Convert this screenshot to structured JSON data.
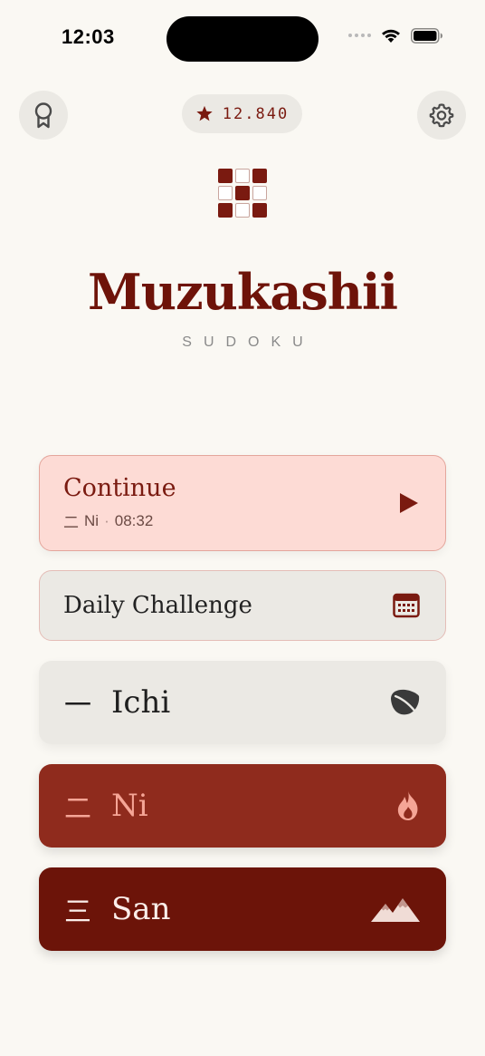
{
  "status_bar": {
    "time": "12:03"
  },
  "header": {
    "score": "12.840",
    "icons": {
      "left": "award-ribbon-icon",
      "score": "star-icon",
      "right": "gear-icon"
    }
  },
  "branding": {
    "title": "Muzukashii",
    "subtitle": "SUDOKU"
  },
  "continue_card": {
    "label": "Continue",
    "level_kanji": "二",
    "level_name": "Ni",
    "elapsed": "08:32",
    "icon": "play-icon"
  },
  "daily_card": {
    "label": "Daily Challenge",
    "icon": "calendar-icon"
  },
  "levels": [
    {
      "kanji": "一",
      "name": "Ichi",
      "icon": "leaf-icon"
    },
    {
      "kanji": "二",
      "name": "Ni",
      "icon": "flame-icon"
    },
    {
      "kanji": "三",
      "name": "San",
      "icon": "mountain-icon"
    }
  ],
  "colors": {
    "background": "#faf8f3",
    "brand": "#6e1309",
    "continue_bg": "#fddbd5",
    "ni_bg": "#8f2b1d",
    "san_bg": "#6c1409"
  }
}
